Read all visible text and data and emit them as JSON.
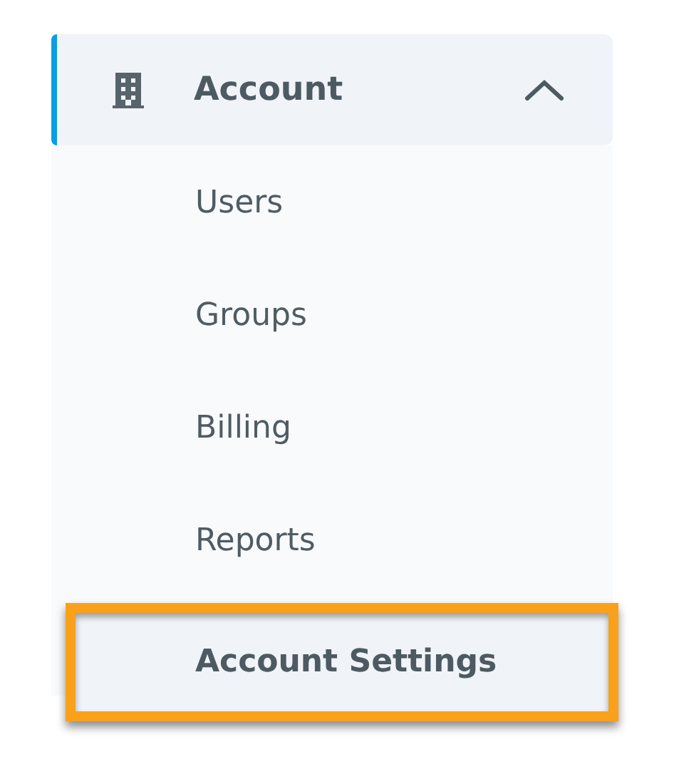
{
  "menu": {
    "label": "Account",
    "expanded": true,
    "items": [
      {
        "label": "Users",
        "selected": false
      },
      {
        "label": "Groups",
        "selected": false
      },
      {
        "label": "Billing",
        "selected": false
      },
      {
        "label": "Reports",
        "selected": false
      },
      {
        "label": "Account Settings",
        "selected": true
      }
    ]
  }
}
